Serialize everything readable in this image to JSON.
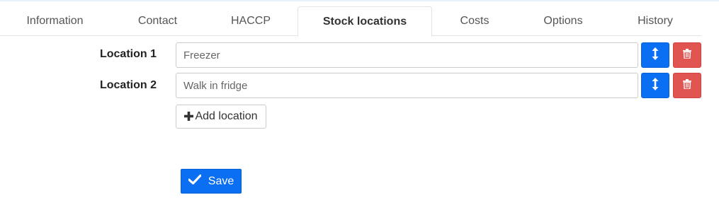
{
  "tabs": [
    {
      "label": "Information"
    },
    {
      "label": "Contact"
    },
    {
      "label": "HACCP"
    },
    {
      "label": "Stock locations",
      "active": true
    },
    {
      "label": "Costs"
    },
    {
      "label": "Options"
    },
    {
      "label": "History"
    }
  ],
  "locations": [
    {
      "label": "Location 1",
      "value": "Freezer"
    },
    {
      "label": "Location 2",
      "value": "Walk in fridge"
    }
  ],
  "icons": {
    "move": "vertical-arrows-icon",
    "delete": "trash-icon",
    "add": "plus-icon",
    "save": "checkmark-icon"
  },
  "actions": {
    "add_location": "Add location",
    "save": "Save"
  },
  "colors": {
    "primary": "#0a6ff2",
    "danger": "#e05552"
  }
}
